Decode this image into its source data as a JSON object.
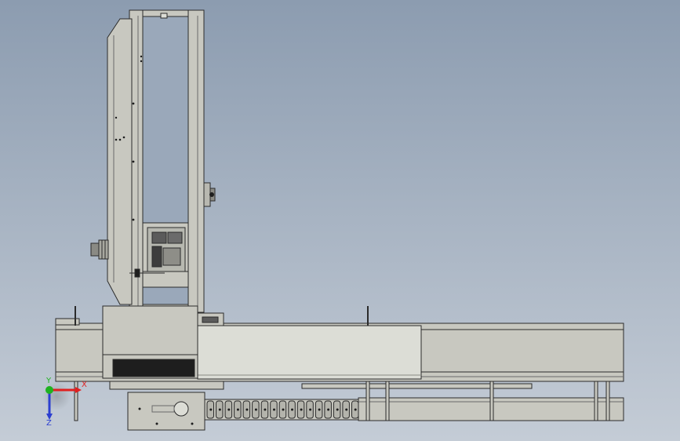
{
  "viewport": {
    "background_top": "#8c9cb0",
    "background_bottom": "#c4ccd6"
  },
  "model": {
    "body_color": "#c8c8c0",
    "light_panel_color": "#dcddd6",
    "edge_color": "#2b2b2b",
    "dark_detail_color": "#1e1e1e",
    "chain_link_count": 17,
    "leg_count": 6
  },
  "triad": {
    "x_label": "X",
    "y_label": "Y",
    "z_label": "Z",
    "x_color": "#e02020",
    "y_color": "#1fb21f",
    "z_color": "#2c3fd0"
  }
}
